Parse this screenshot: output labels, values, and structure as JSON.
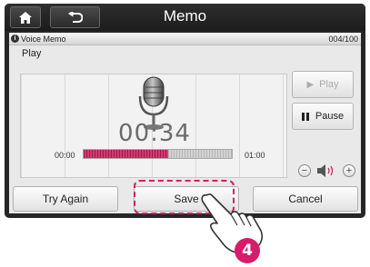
{
  "header": {
    "title": "Memo",
    "home_icon": "home-icon",
    "back_icon": "back-arrow-icon"
  },
  "info_strip": {
    "label": "Voice Memo",
    "count": "004/100",
    "info_icon": "info-icon"
  },
  "mode_label": "Play",
  "player": {
    "mic_icon": "microphone-icon",
    "elapsed": "00:34",
    "start_time": "00:00",
    "end_time": "01:00",
    "progress": 0.57
  },
  "controls": {
    "play_label": "Play",
    "pause_label": "Pause",
    "volume_minus": "−",
    "volume_plus": "+",
    "speaker_icon": "speaker-icon"
  },
  "actions": {
    "try_again": "Try Again",
    "save": "Save",
    "cancel": "Cancel"
  },
  "annotation": {
    "step_number": "4",
    "hand_icon": "pointing-hand-icon"
  },
  "colors": {
    "accent": "#d81b6b",
    "progress_fill": "#c22a62"
  }
}
